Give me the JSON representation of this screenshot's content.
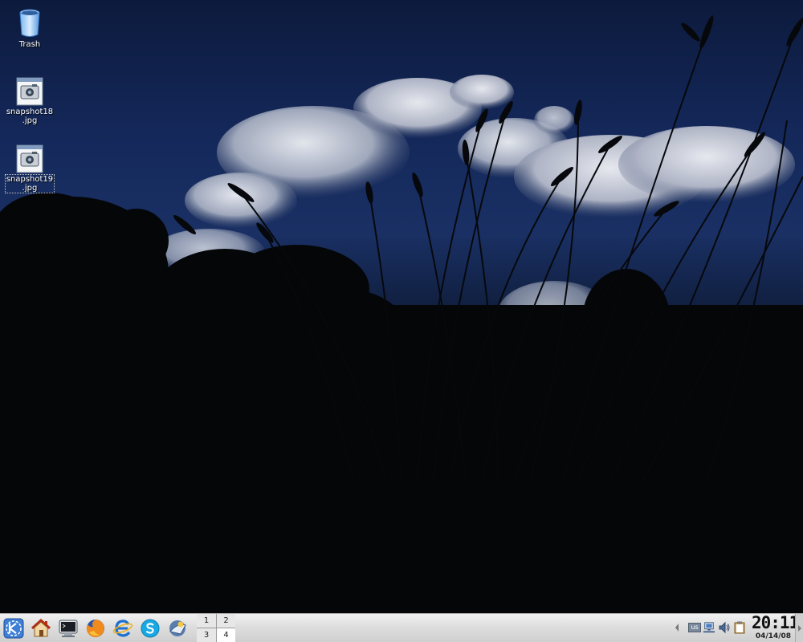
{
  "desktop": {
    "icons": [
      {
        "label": "Trash",
        "icon": "trash-icon"
      },
      {
        "label": "snapshot18\n.jpg",
        "icon": "image-file-icon"
      },
      {
        "label": "snapshot19\n.jpg",
        "icon": "image-file-icon",
        "selected": true
      }
    ]
  },
  "taskbar": {
    "launchers": [
      {
        "name": "kde-menu",
        "icon": "kde-logo-icon"
      },
      {
        "name": "home",
        "icon": "home-icon"
      },
      {
        "name": "terminal",
        "icon": "terminal-icon"
      },
      {
        "name": "firefox",
        "icon": "firefox-icon"
      },
      {
        "name": "browser",
        "icon": "e-browser-icon"
      },
      {
        "name": "skype",
        "icon": "skype-icon"
      },
      {
        "name": "mail",
        "icon": "mail-icon"
      }
    ],
    "pager": {
      "desktops": [
        "1",
        "2",
        "3",
        "4"
      ],
      "active": "4"
    },
    "tray": {
      "keyboard_layout": "us",
      "icons": [
        "network-icon",
        "volume-icon",
        "clipboard-icon"
      ]
    },
    "clock": {
      "time": "20:11",
      "date": "04/14/08"
    }
  },
  "colors": {
    "taskbar": "#dedede",
    "sky": "#14285a",
    "label_text": "#ffffff"
  }
}
